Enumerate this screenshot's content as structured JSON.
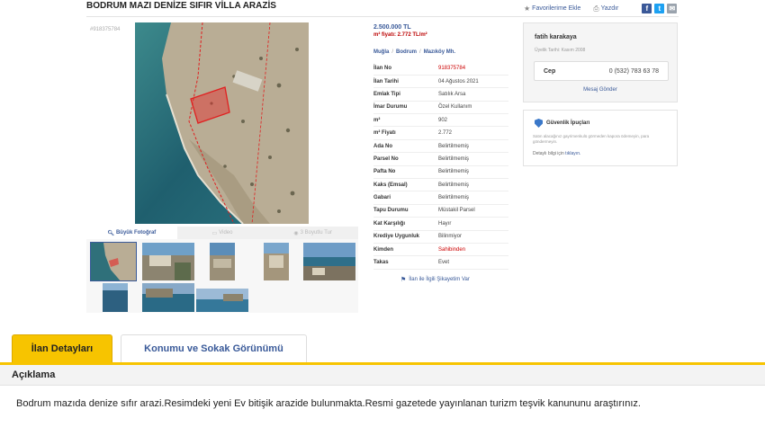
{
  "header": {
    "title": "BODRUM MAZI DENİZE SIFIR VİLLA ARAZİS",
    "favorite_label": "Favorilerime Ekle",
    "print_label": "Yazdır",
    "share_icons": [
      "facebook-icon",
      "twitter-icon",
      "mail-icon"
    ]
  },
  "gallery": {
    "listing_no": "#918375784",
    "tabs": [
      {
        "label": "Büyük Fotoğraf",
        "icon": "search-icon"
      },
      {
        "label": "Video",
        "icon": "video-icon"
      },
      {
        "label": "3 Boyutlu Tur",
        "icon": "3d-tour-icon"
      }
    ]
  },
  "listing": {
    "price": "2.500.000 TL",
    "price_m2": "m² fiyatı: 2.772 TL/m²",
    "breadcrumb": [
      "Muğla",
      "Bodrum",
      "Mazıköy Mh."
    ],
    "details": [
      {
        "key": "İlan No",
        "value": "918375784",
        "highlight": true
      },
      {
        "key": "İlan Tarihi",
        "value": "04 Ağustos 2021"
      },
      {
        "key": "Emlak Tipi",
        "value": "Satılık Arsa"
      },
      {
        "key": "İmar Durumu",
        "value": "Özel Kullanım"
      },
      {
        "key": "m²",
        "value": "902"
      },
      {
        "key": "m² Fiyatı",
        "value": "2.772"
      },
      {
        "key": "Ada No",
        "value": "Belirtilmemiş"
      },
      {
        "key": "Parsel No",
        "value": "Belirtilmemiş"
      },
      {
        "key": "Pafta No",
        "value": "Belirtilmemiş"
      },
      {
        "key": "Kaks (Emsal)",
        "value": "Belirtilmemiş"
      },
      {
        "key": "Gabari",
        "value": "Belirtilmemiş"
      },
      {
        "key": "Tapu Durumu",
        "value": "Müstakil Parsel"
      },
      {
        "key": "Kat Karşılığı",
        "value": "Hayır"
      },
      {
        "key": "Krediye Uygunluk",
        "value": "Bilinmiyor"
      },
      {
        "key": "Kimden",
        "value": "Sahibinden",
        "highlight": true
      },
      {
        "key": "Takas",
        "value": "Evet"
      }
    ],
    "complaint_label": "İlan ile İlgili Şikayetim Var"
  },
  "seller": {
    "name": "fatih karakaya",
    "since": "Üyelik Tarihi: Kasım 2008",
    "phone_label": "Cep",
    "phone_number": "0 (532) 783 63 78",
    "message_label": "Mesaj Gönder"
  },
  "safety": {
    "title": "Güvenlik İpuçları",
    "text": "Satın alacağınız gayrimenkulü görmeden kapora ödemeyin, para göndermeyin.",
    "more_prefix": "Detaylı bilgi için",
    "more_link": "tıklayın."
  },
  "tabs": {
    "details_label": "İlan Detayları",
    "location_label": "Konumu ve Sokak Görünümü"
  },
  "description": {
    "heading": "Açıklama",
    "text": "Bodrum mazıda denize sıfır arazi.Resimdeki yeni Ev bitişik arazide bulunmakta.Resmi gazetede yayınlanan turizm teşvik kanununu araştırınız."
  },
  "colors": {
    "accent_yellow": "#f7c400",
    "link_blue": "#3a5a99",
    "highlight_red": "#c00000"
  }
}
